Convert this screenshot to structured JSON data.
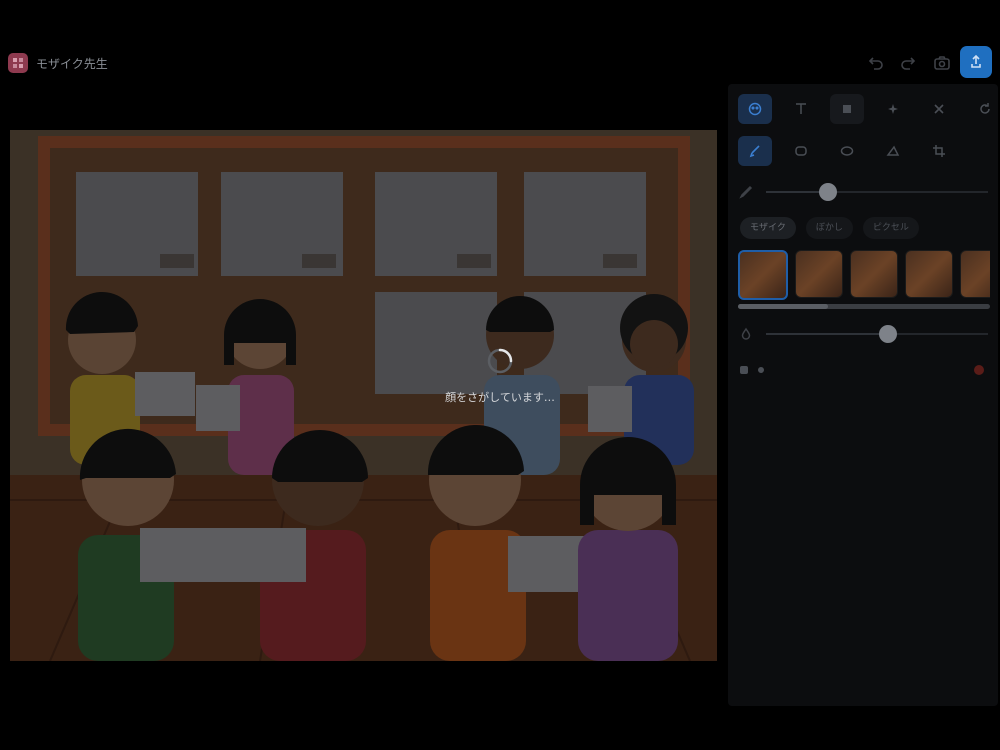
{
  "app": {
    "title": "モザイク先生"
  },
  "loading": {
    "message": "顔をさがしています…"
  },
  "panel": {
    "mode_chips": [
      "モザイク",
      "ぼかし",
      "ピクセル"
    ],
    "brush_size_fraction": 0.28,
    "strength_fraction": 0.55,
    "thumbnail_count": 5
  },
  "colors": {
    "accent": "#1f6fc0",
    "panel_bg": "#0c0d0f",
    "page_bg": "#000000"
  }
}
